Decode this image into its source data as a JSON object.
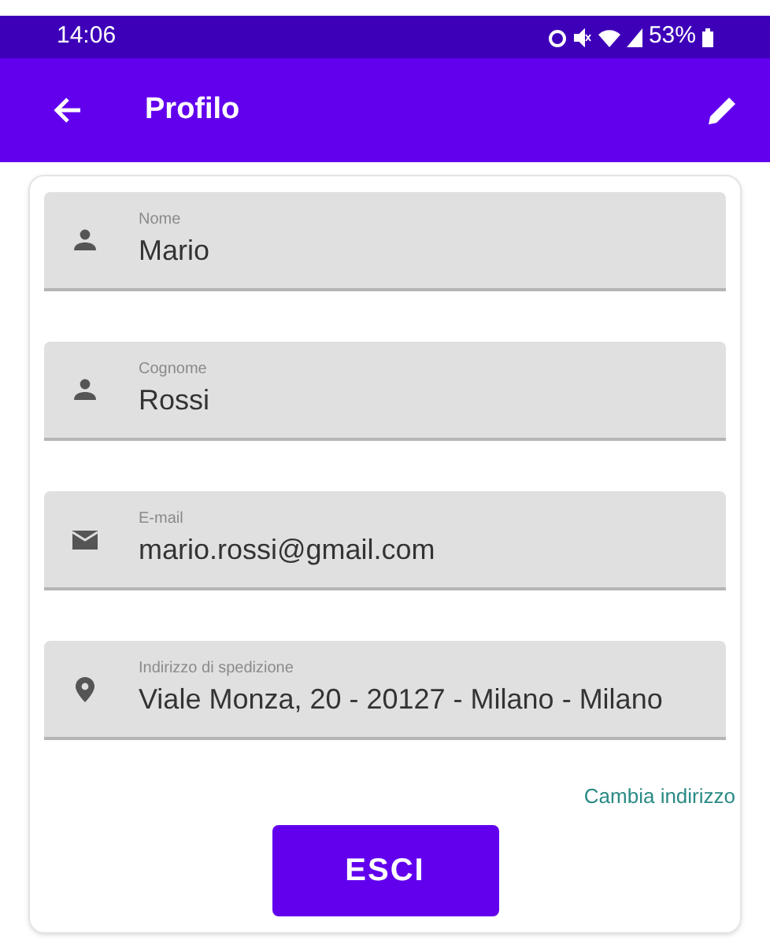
{
  "status_bar": {
    "time": "14:06",
    "battery": "53%"
  },
  "app_bar": {
    "title": "Profilo"
  },
  "fields": [
    {
      "kind": "person",
      "label": "Nome",
      "value": "Mario"
    },
    {
      "kind": "person",
      "label": "Cognome",
      "value": "Rossi"
    },
    {
      "kind": "email",
      "label": "E-mail",
      "value": "mario.rossi@gmail.com"
    },
    {
      "kind": "location",
      "label": "Indirizzo di spedizione",
      "value": "Viale Monza, 20 - 20127 - Milano - Milano"
    }
  ],
  "change_address_link": "Cambia indirizzo",
  "logout_button": "ESCI"
}
